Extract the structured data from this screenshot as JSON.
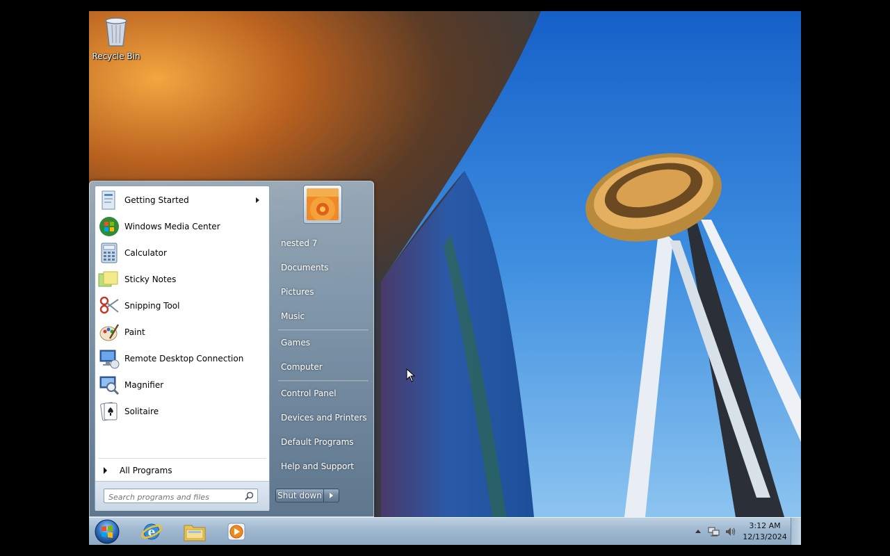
{
  "desktop": {
    "icons": [
      {
        "label": "Recycle Bin",
        "icon": "recycle-bin-icon"
      }
    ]
  },
  "start_menu": {
    "pinned_programs": [
      {
        "label": "Getting Started",
        "icon": "getting-started-icon",
        "has_submenu": true
      },
      {
        "label": "Windows Media Center",
        "icon": "windows-media-center-icon"
      },
      {
        "label": "Calculator",
        "icon": "calculator-icon"
      },
      {
        "label": "Sticky Notes",
        "icon": "sticky-notes-icon"
      },
      {
        "label": "Snipping Tool",
        "icon": "snipping-tool-icon"
      },
      {
        "label": "Paint",
        "icon": "paint-icon"
      },
      {
        "label": "Remote Desktop Connection",
        "icon": "remote-desktop-icon"
      },
      {
        "label": "Magnifier",
        "icon": "magnifier-icon"
      },
      {
        "label": "Solitaire",
        "icon": "solitaire-icon"
      }
    ],
    "all_programs_label": "All Programs",
    "search_placeholder": "Search programs and files",
    "right_links": [
      {
        "label": "nested 7"
      },
      {
        "label": "Documents"
      },
      {
        "label": "Pictures"
      },
      {
        "label": "Music"
      },
      {
        "label": "Games"
      },
      {
        "label": "Computer"
      },
      {
        "label": "Control Panel"
      },
      {
        "label": "Devices and Printers"
      },
      {
        "label": "Default Programs"
      },
      {
        "label": "Help and Support"
      }
    ],
    "shutdown_label": "Shut down"
  },
  "taskbar": {
    "pinned": [
      {
        "name": "internet-explorer-icon"
      },
      {
        "name": "windows-explorer-icon"
      },
      {
        "name": "media-player-icon"
      }
    ],
    "clock": {
      "time": "3:12 AM",
      "date": "12/13/2024"
    }
  }
}
